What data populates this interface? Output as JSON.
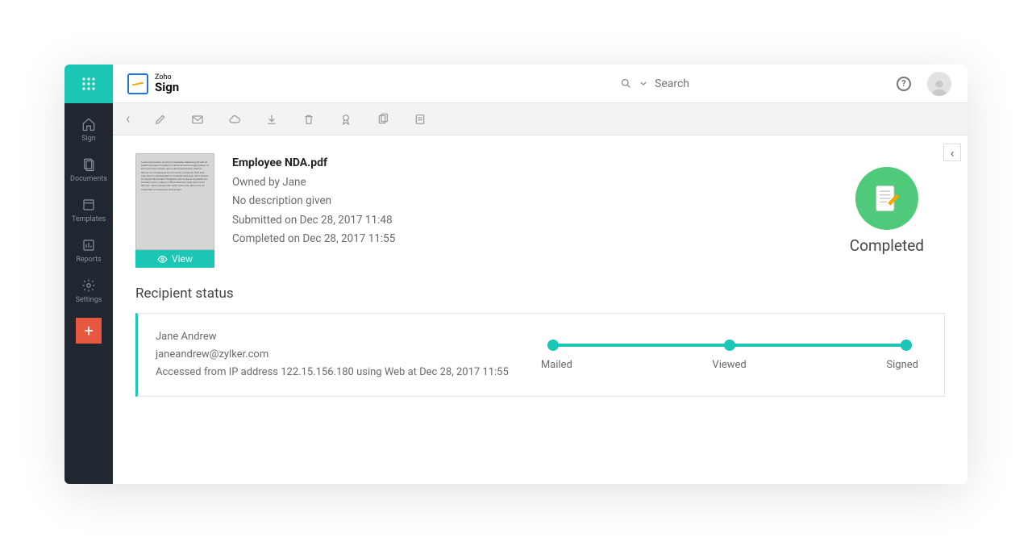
{
  "brand": {
    "company": "Zoho",
    "product": "Sign"
  },
  "search": {
    "placeholder": "Search"
  },
  "sidebar": {
    "items": [
      {
        "label": "Sign"
      },
      {
        "label": "Documents"
      },
      {
        "label": "Templates"
      },
      {
        "label": "Reports"
      },
      {
        "label": "Settings"
      }
    ]
  },
  "toolbar": {
    "back": "‹"
  },
  "document": {
    "title": "Employee NDA.pdf",
    "owner": "Owned by Jane",
    "description": "No description given",
    "submitted": "Submitted on Dec 28, 2017 11:48",
    "completed": "Completed on Dec 28, 2017 11:55",
    "view_label": "View",
    "status": "Completed"
  },
  "recipient": {
    "heading": "Recipient status",
    "name": "Jane Andrew",
    "email": "janeandrew@zylker.com",
    "access_info": "Accessed from IP address 122.15.156.180 using Web at Dec 28, 2017 11:55",
    "stages": [
      "Mailed",
      "Viewed",
      "Signed"
    ]
  },
  "collapse_toggle": "‹"
}
